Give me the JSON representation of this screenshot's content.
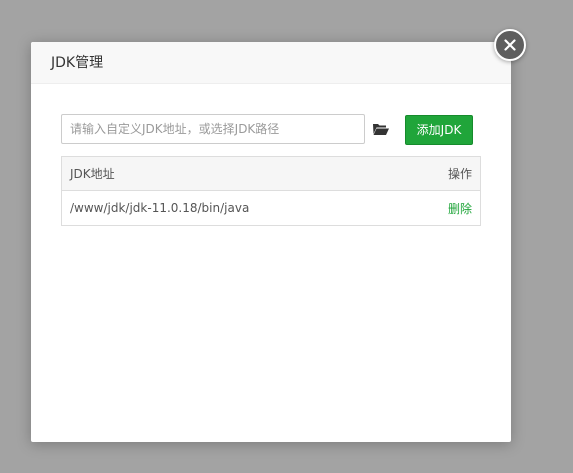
{
  "dialog": {
    "title": "JDK管理"
  },
  "toolbar": {
    "path_input_placeholder": "请输入自定义JDK地址，或选择JDK路径",
    "path_input_value": "",
    "add_button_label": "添加JDK"
  },
  "table": {
    "columns": [
      "JDK地址",
      "操作"
    ],
    "rows": [
      {
        "path": "/www/jdk/jdk-11.0.18/bin/java",
        "action": "删除"
      }
    ]
  },
  "colors": {
    "accent": "#20a53a",
    "backdrop": "#a3a3a3",
    "close_button": "#5e5e5e"
  },
  "icons": {
    "close": "close-icon",
    "folder": "folder-open-icon"
  }
}
